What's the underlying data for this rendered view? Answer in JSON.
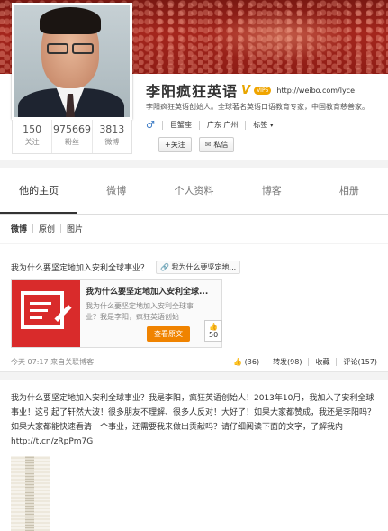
{
  "profile": {
    "name": "李阳疯狂英语",
    "badge": "V",
    "vip": "VIP5",
    "site_link": "http://weibo.com/lyce",
    "bio": "李阳疯狂英语创始人。全球著名英语口语教育专家，中国教育慈善家。",
    "stats": [
      {
        "value": "150",
        "label": "关注"
      },
      {
        "value": "975669",
        "label": "粉丝"
      },
      {
        "value": "3813",
        "label": "微博"
      }
    ],
    "gender_icon": "male-icon",
    "constellation": "巨蟹座",
    "location": "广东 广州",
    "tags_label": "标签",
    "follow_label": "+关注",
    "message_label": "私信"
  },
  "tabs": [
    {
      "label": "他的主页",
      "active": true
    },
    {
      "label": "微博"
    },
    {
      "label": "个人资料"
    },
    {
      "label": "博客"
    },
    {
      "label": "相册"
    }
  ],
  "feed_filter": [
    "微博",
    "原创",
    "图片"
  ],
  "post1": {
    "text": "我为什么要坚定地加入安利全球事业？",
    "link_chip": "我为什么要坚定地...",
    "card": {
      "title": "我为什么要坚定地加入安利全球...",
      "desc_line1": "我为什么要坚定地加入安利全球事",
      "desc_line2": "业？我是李阳，疯狂英语创始",
      "read_btn": "查看原文",
      "likes": "50"
    },
    "time": "今天 07:17",
    "source": "来自关联博客",
    "like_count": "(36)",
    "repost": "转发(98)",
    "fav": "收藏",
    "comment": "评论(157)"
  },
  "post2": {
    "text": "我为什么要坚定地加入安利全球事业？我是李阳，疯狂英语创始人！2013年10月，我加入了安利全球事业！这引起了轩然大波！很多朋友不理解、很多人反对！大好了！如果大家都赞成，我还是李阳吗？如果大家都能快速看清一个事业，还需要我来做出贡献吗？请仔细阅读下面的文字，了解我内",
    "link": "http://t.cn/zRpPm7G"
  }
}
